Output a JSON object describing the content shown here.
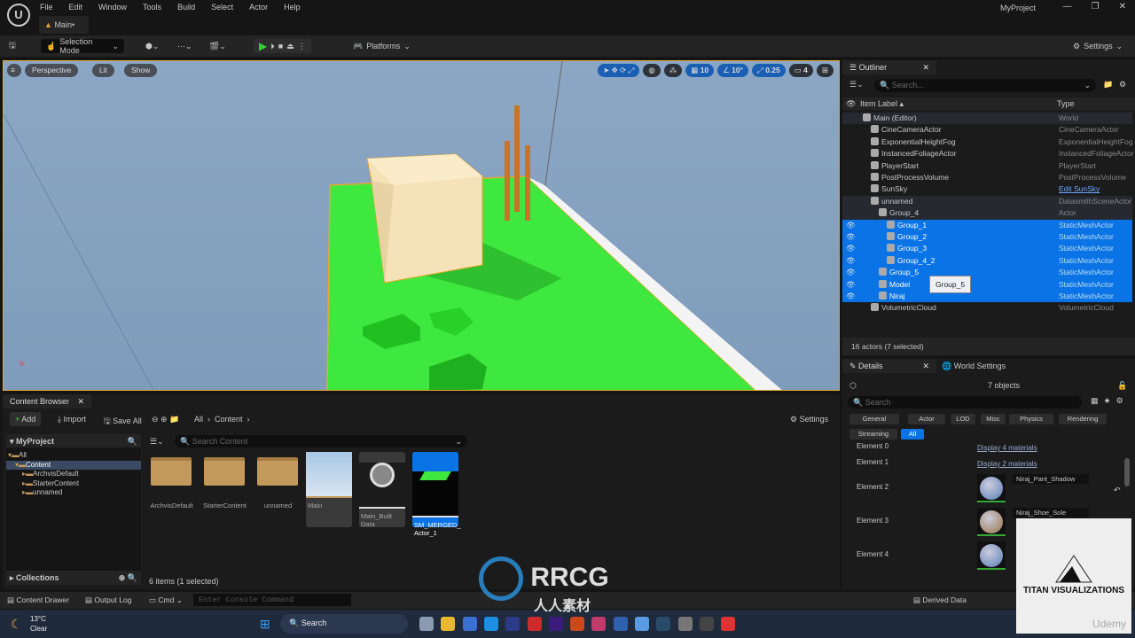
{
  "menubar": {
    "items": [
      "File",
      "Edit",
      "Window",
      "Tools",
      "Build",
      "Select",
      "Actor",
      "Help"
    ],
    "project": "MyProject"
  },
  "tab": {
    "label": "Main•"
  },
  "toolbar": {
    "selection_mode": "Selection Mode",
    "platforms": "Platforms",
    "settings": "Settings"
  },
  "viewport": {
    "perspective": "Perspective",
    "lit": "Lit",
    "show": "Show",
    "grid_snap": "10",
    "rot_snap": "10°",
    "scale_snap": "0.25",
    "camera_speed": "4"
  },
  "outliner": {
    "title": "Outliner",
    "search_placeholder": "Search...",
    "col_label": "Item Label ▴",
    "col_type": "Type",
    "status": "16 actors (7 selected)",
    "tooltip": "Group_5",
    "rows": [
      {
        "label": "Main (Editor)",
        "type": "World",
        "indent": 1,
        "state": "grey"
      },
      {
        "label": "CineCameraActor",
        "type": "CineCameraActor",
        "indent": 2
      },
      {
        "label": "ExponentialHeightFog",
        "type": "ExponentialHeightFog",
        "indent": 2
      },
      {
        "label": "InstancedFoliageActor",
        "type": "InstancedFoliageActor",
        "indent": 2
      },
      {
        "label": "PlayerStart",
        "type": "PlayerStart",
        "indent": 2
      },
      {
        "label": "PostProcessVolume",
        "type": "PostProcessVolume",
        "indent": 2
      },
      {
        "label": "SunSky",
        "type": "Edit SunSky",
        "indent": 2,
        "link": true
      },
      {
        "label": "unnamed",
        "type": "DatasmithSceneActor",
        "indent": 2,
        "state": "grey"
      },
      {
        "label": "Group_4",
        "type": "Actor",
        "indent": 3,
        "state": "grey"
      },
      {
        "label": "Group_1",
        "type": "StaticMeshActor",
        "indent": 4,
        "state": "sel"
      },
      {
        "label": "Group_2",
        "type": "StaticMeshActor",
        "indent": 4,
        "state": "sel"
      },
      {
        "label": "Group_3",
        "type": "StaticMeshActor",
        "indent": 4,
        "state": "sel"
      },
      {
        "label": "Group_4_2",
        "type": "StaticMeshActor",
        "indent": 4,
        "state": "sel"
      },
      {
        "label": "Group_5",
        "type": "StaticMeshActor",
        "indent": 3,
        "state": "sel"
      },
      {
        "label": "Model",
        "type": "StaticMeshActor",
        "indent": 3,
        "state": "sel"
      },
      {
        "label": "Niraj",
        "type": "StaticMeshActor",
        "indent": 3,
        "state": "sel"
      },
      {
        "label": "VolumetricCloud",
        "type": "VolumetricCloud",
        "indent": 2
      }
    ]
  },
  "details": {
    "title": "Details",
    "world_settings": "World Settings",
    "objects": "7 objects",
    "search_placeholder": "Search",
    "filters": [
      "General",
      "Actor",
      "LOD",
      "Misc",
      "Physics",
      "Rendering",
      "Streaming",
      "All"
    ],
    "elements": [
      {
        "label": "Element 0",
        "value": "Display 4 materials"
      },
      {
        "label": "Element 1",
        "value": "Display 2 materials"
      },
      {
        "label": "Element 2",
        "value": "Niraj_Pant_Shadow"
      },
      {
        "label": "Element 3",
        "value": "Niraj_Shoe_Sole"
      },
      {
        "label": "Element 4",
        "value": ""
      }
    ]
  },
  "content_browser": {
    "title": "Content Browser",
    "add": "Add",
    "import": "Import",
    "save_all": "Save All",
    "path": [
      "All",
      "Content"
    ],
    "settings": "Settings",
    "root": "MyProject",
    "search_placeholder": "Search Content",
    "tree": [
      "All",
      "Content",
      "ArchvisDefault",
      "StarterContent",
      "unnamed"
    ],
    "collections": "Collections",
    "status": "6 items (1 selected)",
    "folders": [
      "ArchvisDefault",
      "StarterContent",
      "unnamed"
    ],
    "assets": [
      "Main",
      "Main_Built Data",
      "SM_MERGED_ Actor_1"
    ]
  },
  "bottombar": {
    "content_drawer": "Content Drawer",
    "output_log": "Output Log",
    "cmd": "Cmd",
    "console_placeholder": "Enter Console Command",
    "derived_data": "Derived Data"
  },
  "taskbar": {
    "temp": "13°C",
    "weather": "Clear",
    "search": "Search"
  },
  "watermarks": {
    "titan": "TITAN VISUALIZATIONS",
    "udemy": "Udemy",
    "rrcg": "RRCG",
    "rrcg_sub": "人人素材"
  },
  "colors": {
    "selection": "#0a73e6",
    "accent": "#e7a72d",
    "ground": "#3ee83e"
  }
}
